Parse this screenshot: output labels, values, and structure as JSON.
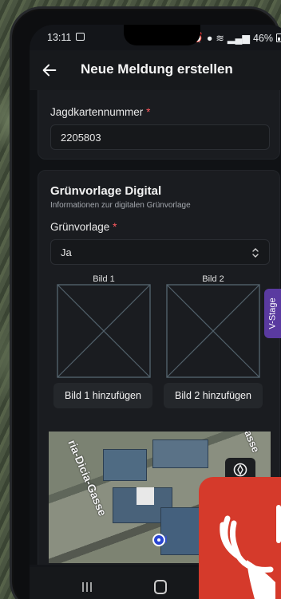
{
  "status_bar": {
    "time": "13:11",
    "battery": "46%"
  },
  "app_bar": {
    "title": "Neue Meldung erstellen",
    "back_icon": "arrow-left-icon"
  },
  "jagdkarte": {
    "label": "Jagdkartennummer",
    "required_mark": "*",
    "value": "2205803"
  },
  "gruenvorlage": {
    "title": "Grünvorlage Digital",
    "subtitle": "Informationen zur digitalen Grünvorlage",
    "select_label": "Grünvorlage",
    "required_mark": "*",
    "select_value": "Ja",
    "image1_label": "Bild 1",
    "image2_label": "Bild 2",
    "add_image1": "Bild 1 hinzufügen",
    "add_image2": "Bild 2 hinzufügen"
  },
  "map": {
    "street_label_1": "ria-Dicia-Gasse",
    "street_label_2": "asse",
    "compass_icon": "compass-icon"
  },
  "side_tab": {
    "label": "V-Stage"
  },
  "colors": {
    "accent_required": "#ff5a5f",
    "side_tab": "#5a3aa0",
    "logo_red": "#d53a2b"
  }
}
